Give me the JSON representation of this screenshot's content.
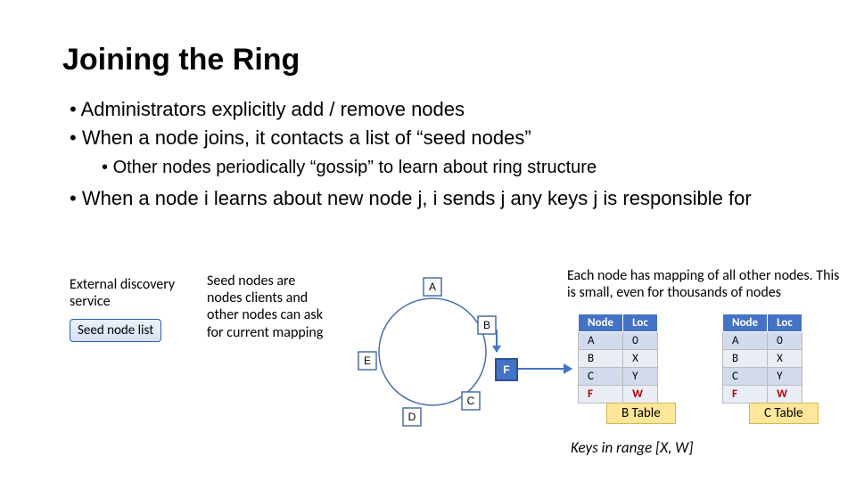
{
  "title": "Joining the Ring",
  "bullets": {
    "b1": "Administrators explicitly add / remove nodes",
    "b2": "When a node joins, it contacts a list of “seed nodes”",
    "b2s": "Other nodes periodically “gossip” to learn about ring structure",
    "b3": "When a node i learns about new node j, i sends j any keys j is responsible for"
  },
  "left_col": {
    "heading": "External discovery service",
    "button": "Seed node list"
  },
  "mid_col": "Seed nodes are nodes clients and other nodes can ask for current mapping",
  "ring_nodes": {
    "a": "A",
    "b": "B",
    "c": "C",
    "d": "D",
    "e": "E"
  },
  "f_label": "F",
  "map_text": "Each node has mapping of all other nodes. This is small, even for thousands of nodes",
  "table_headers": {
    "node": "Node",
    "loc": "Loc"
  },
  "table_b": {
    "caption": "B Table",
    "rows": [
      {
        "node": "A",
        "loc": "0"
      },
      {
        "node": "B",
        "loc": "X"
      },
      {
        "node": "C",
        "loc": "Y"
      },
      {
        "node": "F",
        "loc": "W"
      }
    ]
  },
  "table_c": {
    "caption": "C Table",
    "rows": [
      {
        "node": "A",
        "loc": "0"
      },
      {
        "node": "B",
        "loc": "X"
      },
      {
        "node": "C",
        "loc": "Y"
      },
      {
        "node": "F",
        "loc": "W"
      }
    ]
  },
  "keys_range": "Keys in range [X, W]"
}
